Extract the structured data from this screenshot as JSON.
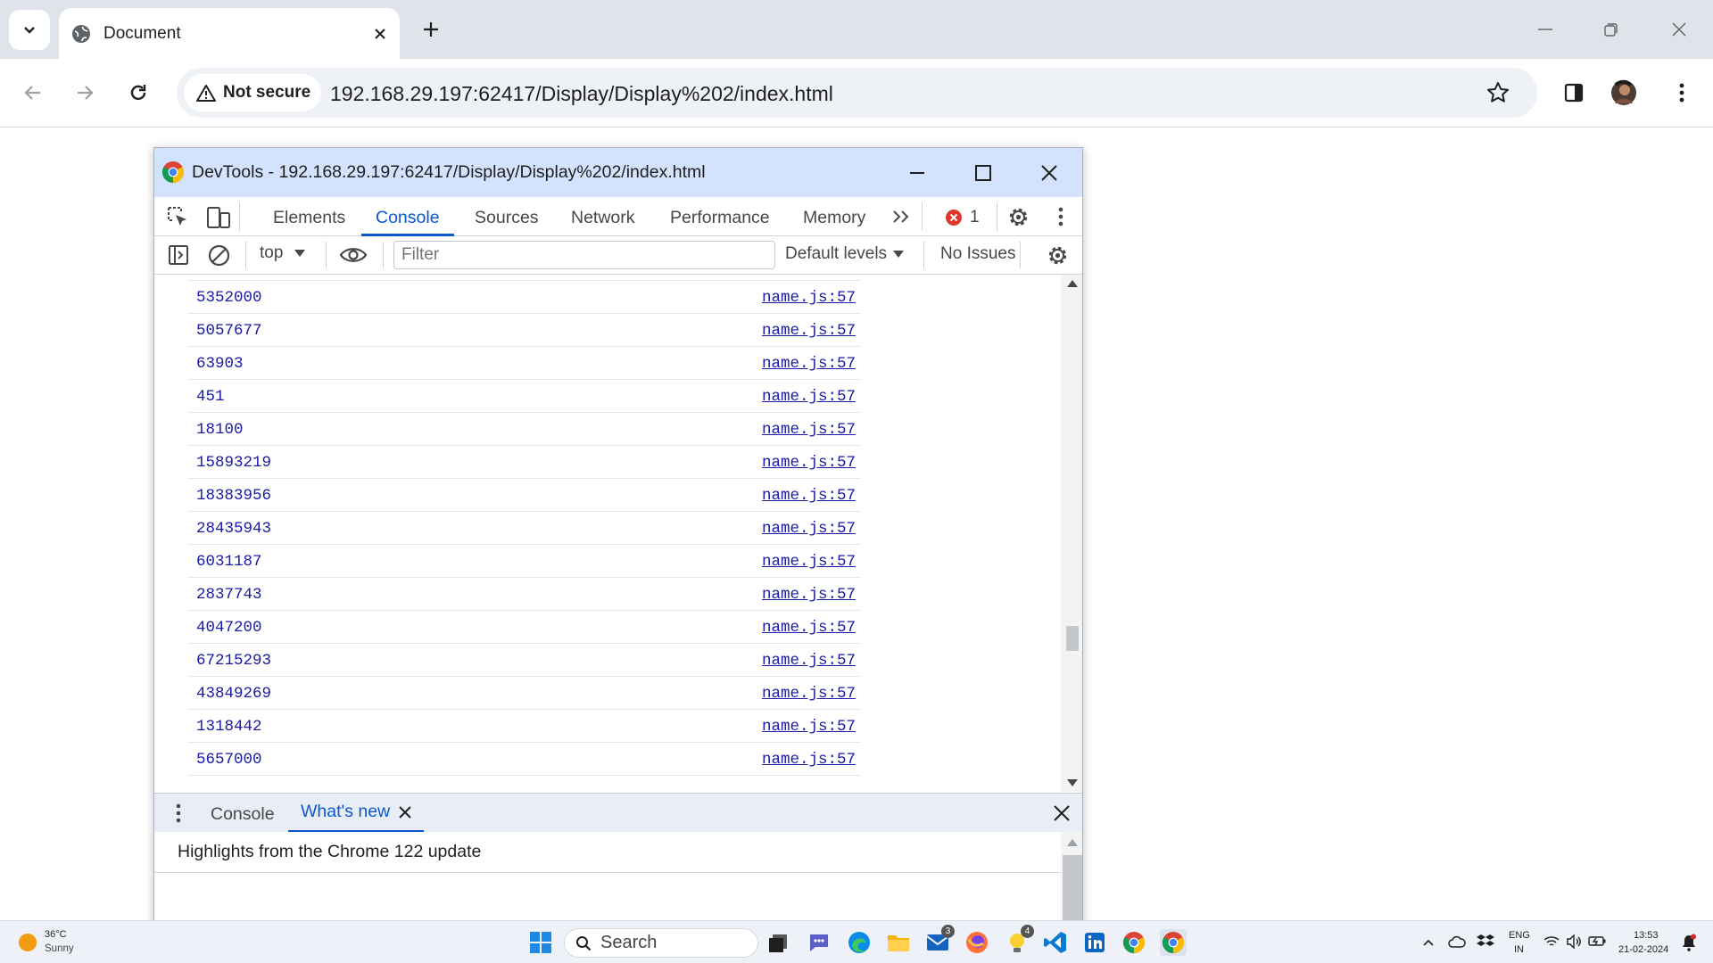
{
  "browser": {
    "tab_title": "Document",
    "security_label": "Not secure",
    "url": "192.168.29.197:62417/Display/Display%202/index.html"
  },
  "devtools": {
    "window_title": "DevTools - 192.168.29.197:62417/Display/Display%202/index.html",
    "tabs": [
      "Elements",
      "Console",
      "Sources",
      "Network",
      "Performance",
      "Memory"
    ],
    "active_tab": "Console",
    "error_count": "1",
    "console_toolbar": {
      "context": "top",
      "filter_placeholder": "Filter",
      "levels": "Default levels",
      "issues": "No Issues"
    },
    "console_rows": [
      {
        "value": "5352000",
        "source": "name.js:57"
      },
      {
        "value": "5057677",
        "source": "name.js:57"
      },
      {
        "value": "63903",
        "source": "name.js:57"
      },
      {
        "value": "451",
        "source": "name.js:57"
      },
      {
        "value": "18100",
        "source": "name.js:57"
      },
      {
        "value": "15893219",
        "source": "name.js:57"
      },
      {
        "value": "18383956",
        "source": "name.js:57"
      },
      {
        "value": "28435943",
        "source": "name.js:57"
      },
      {
        "value": "6031187",
        "source": "name.js:57"
      },
      {
        "value": "2837743",
        "source": "name.js:57"
      },
      {
        "value": "4047200",
        "source": "name.js:57"
      },
      {
        "value": "67215293",
        "source": "name.js:57"
      },
      {
        "value": "43849269",
        "source": "name.js:57"
      },
      {
        "value": "1318442",
        "source": "name.js:57"
      },
      {
        "value": "5657000",
        "source": "name.js:57"
      }
    ],
    "drawer": {
      "tabs": [
        "Console",
        "What's new"
      ],
      "active_tab": "What's new",
      "whats_new_heading": "Highlights from the Chrome 122 update"
    }
  },
  "taskbar": {
    "weather_temp": "36°C",
    "weather_desc": "Sunny",
    "search_label": "Search",
    "mail_badge": "3",
    "notes_badge": "4",
    "language_line1": "ENG",
    "language_line2": "IN",
    "time": "13:53",
    "date": "21-02-2024"
  }
}
